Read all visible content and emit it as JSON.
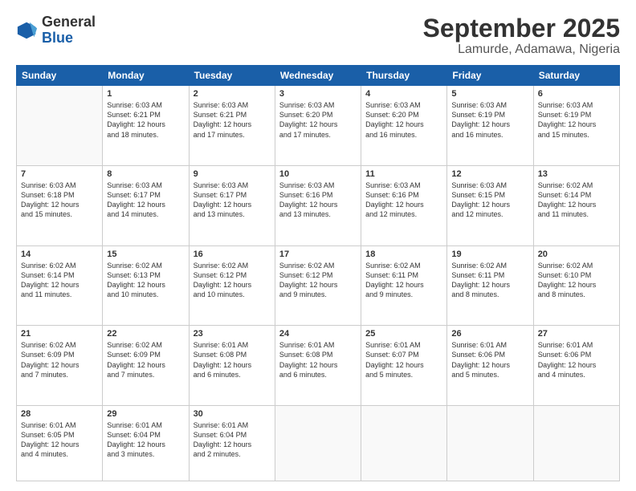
{
  "logo": {
    "line1": "General",
    "line2": "Blue"
  },
  "header": {
    "month": "September 2025",
    "location": "Lamurde, Adamawa, Nigeria"
  },
  "weekdays": [
    "Sunday",
    "Monday",
    "Tuesday",
    "Wednesday",
    "Thursday",
    "Friday",
    "Saturday"
  ],
  "weeks": [
    [
      {
        "day": "",
        "info": ""
      },
      {
        "day": "1",
        "info": "Sunrise: 6:03 AM\nSunset: 6:21 PM\nDaylight: 12 hours\nand 18 minutes."
      },
      {
        "day": "2",
        "info": "Sunrise: 6:03 AM\nSunset: 6:21 PM\nDaylight: 12 hours\nand 17 minutes."
      },
      {
        "day": "3",
        "info": "Sunrise: 6:03 AM\nSunset: 6:20 PM\nDaylight: 12 hours\nand 17 minutes."
      },
      {
        "day": "4",
        "info": "Sunrise: 6:03 AM\nSunset: 6:20 PM\nDaylight: 12 hours\nand 16 minutes."
      },
      {
        "day": "5",
        "info": "Sunrise: 6:03 AM\nSunset: 6:19 PM\nDaylight: 12 hours\nand 16 minutes."
      },
      {
        "day": "6",
        "info": "Sunrise: 6:03 AM\nSunset: 6:19 PM\nDaylight: 12 hours\nand 15 minutes."
      }
    ],
    [
      {
        "day": "7",
        "info": "Sunrise: 6:03 AM\nSunset: 6:18 PM\nDaylight: 12 hours\nand 15 minutes."
      },
      {
        "day": "8",
        "info": "Sunrise: 6:03 AM\nSunset: 6:17 PM\nDaylight: 12 hours\nand 14 minutes."
      },
      {
        "day": "9",
        "info": "Sunrise: 6:03 AM\nSunset: 6:17 PM\nDaylight: 12 hours\nand 13 minutes."
      },
      {
        "day": "10",
        "info": "Sunrise: 6:03 AM\nSunset: 6:16 PM\nDaylight: 12 hours\nand 13 minutes."
      },
      {
        "day": "11",
        "info": "Sunrise: 6:03 AM\nSunset: 6:16 PM\nDaylight: 12 hours\nand 12 minutes."
      },
      {
        "day": "12",
        "info": "Sunrise: 6:03 AM\nSunset: 6:15 PM\nDaylight: 12 hours\nand 12 minutes."
      },
      {
        "day": "13",
        "info": "Sunrise: 6:02 AM\nSunset: 6:14 PM\nDaylight: 12 hours\nand 11 minutes."
      }
    ],
    [
      {
        "day": "14",
        "info": "Sunrise: 6:02 AM\nSunset: 6:14 PM\nDaylight: 12 hours\nand 11 minutes."
      },
      {
        "day": "15",
        "info": "Sunrise: 6:02 AM\nSunset: 6:13 PM\nDaylight: 12 hours\nand 10 minutes."
      },
      {
        "day": "16",
        "info": "Sunrise: 6:02 AM\nSunset: 6:12 PM\nDaylight: 12 hours\nand 10 minutes."
      },
      {
        "day": "17",
        "info": "Sunrise: 6:02 AM\nSunset: 6:12 PM\nDaylight: 12 hours\nand 9 minutes."
      },
      {
        "day": "18",
        "info": "Sunrise: 6:02 AM\nSunset: 6:11 PM\nDaylight: 12 hours\nand 9 minutes."
      },
      {
        "day": "19",
        "info": "Sunrise: 6:02 AM\nSunset: 6:11 PM\nDaylight: 12 hours\nand 8 minutes."
      },
      {
        "day": "20",
        "info": "Sunrise: 6:02 AM\nSunset: 6:10 PM\nDaylight: 12 hours\nand 8 minutes."
      }
    ],
    [
      {
        "day": "21",
        "info": "Sunrise: 6:02 AM\nSunset: 6:09 PM\nDaylight: 12 hours\nand 7 minutes."
      },
      {
        "day": "22",
        "info": "Sunrise: 6:02 AM\nSunset: 6:09 PM\nDaylight: 12 hours\nand 7 minutes."
      },
      {
        "day": "23",
        "info": "Sunrise: 6:01 AM\nSunset: 6:08 PM\nDaylight: 12 hours\nand 6 minutes."
      },
      {
        "day": "24",
        "info": "Sunrise: 6:01 AM\nSunset: 6:08 PM\nDaylight: 12 hours\nand 6 minutes."
      },
      {
        "day": "25",
        "info": "Sunrise: 6:01 AM\nSunset: 6:07 PM\nDaylight: 12 hours\nand 5 minutes."
      },
      {
        "day": "26",
        "info": "Sunrise: 6:01 AM\nSunset: 6:06 PM\nDaylight: 12 hours\nand 5 minutes."
      },
      {
        "day": "27",
        "info": "Sunrise: 6:01 AM\nSunset: 6:06 PM\nDaylight: 12 hours\nand 4 minutes."
      }
    ],
    [
      {
        "day": "28",
        "info": "Sunrise: 6:01 AM\nSunset: 6:05 PM\nDaylight: 12 hours\nand 4 minutes."
      },
      {
        "day": "29",
        "info": "Sunrise: 6:01 AM\nSunset: 6:04 PM\nDaylight: 12 hours\nand 3 minutes."
      },
      {
        "day": "30",
        "info": "Sunrise: 6:01 AM\nSunset: 6:04 PM\nDaylight: 12 hours\nand 2 minutes."
      },
      {
        "day": "",
        "info": ""
      },
      {
        "day": "",
        "info": ""
      },
      {
        "day": "",
        "info": ""
      },
      {
        "day": "",
        "info": ""
      }
    ]
  ]
}
